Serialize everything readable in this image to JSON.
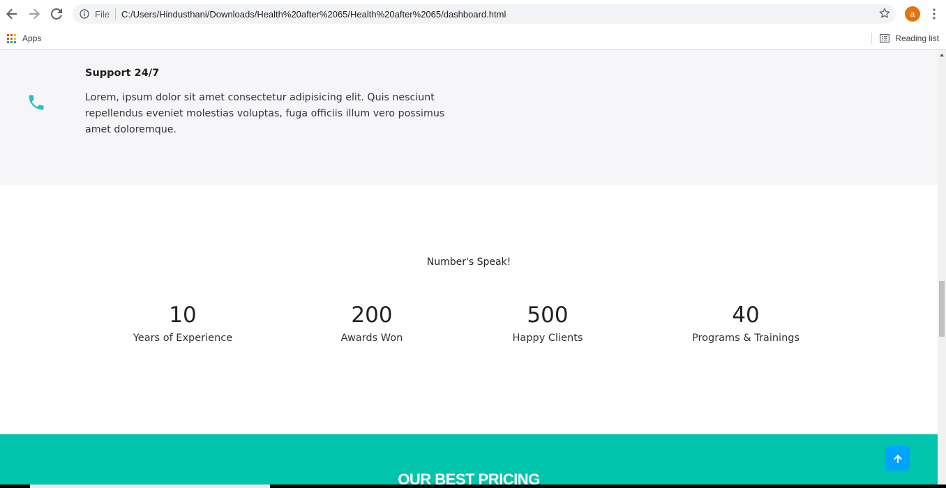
{
  "browser": {
    "address": {
      "scheme_label": "File",
      "url": "C:/Users/Hindusthani/Downloads/Health%20after%2065/Health%20after%2065/dashboard.html"
    },
    "profile_initial": "a",
    "bookmarks": {
      "apps_label": "Apps",
      "reading_list_label": "Reading list"
    }
  },
  "support": {
    "title": "Support  24/7",
    "description": "Lorem, ipsum dolor sit amet consectetur adipisicing elit. Quis nesciunt repellendus eveniet molestias voluptas, fuga officiis illum vero possimus amet doloremque."
  },
  "numbers": {
    "heading": "Number's Speak!",
    "stats": [
      {
        "value": "10",
        "label": "Years of Experience"
      },
      {
        "value": "200",
        "label": "Awards Won"
      },
      {
        "value": "500",
        "label": "Happy Clients"
      },
      {
        "value": "40",
        "label": "Programs & Trainings"
      }
    ]
  },
  "pricing": {
    "title": "OUR BEST PRICING"
  },
  "colors": {
    "accent_teal": "#00c4ab",
    "phone_icon": "#2bbfbd",
    "scroll_top_button": "#00a3ff",
    "profile_avatar": "#e8710a"
  },
  "icons": {
    "back": "arrow-left-icon",
    "forward": "arrow-right-icon",
    "reload": "reload-icon",
    "info": "info-icon",
    "bookmark_star": "star-icon",
    "menu": "kebab-menu-icon",
    "apps": "apps-grid-icon",
    "reading_list": "reading-list-icon",
    "support": "phone-icon",
    "scroll_top": "arrow-up-icon"
  }
}
